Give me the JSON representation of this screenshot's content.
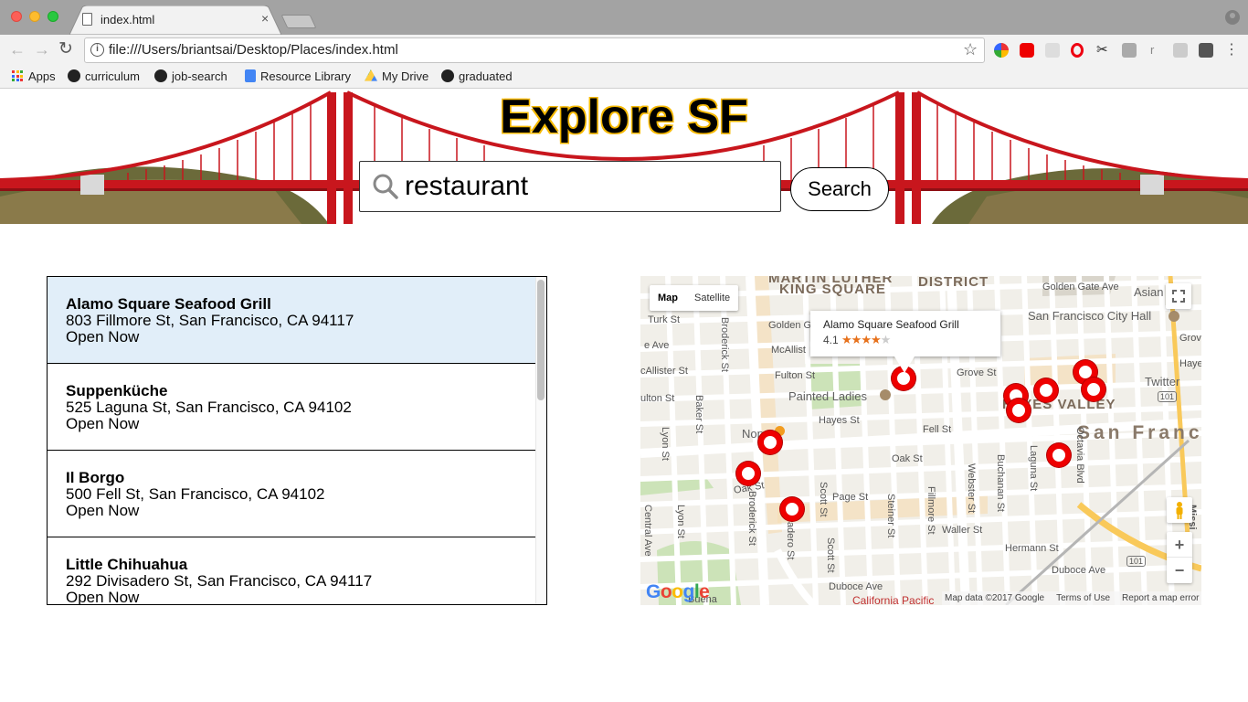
{
  "browser": {
    "tab_title": "index.html",
    "tab_close": "×",
    "url": "file:///Users/briantsai/Desktop/Places/index.html",
    "bookmarks": [
      {
        "label": "Apps",
        "icon": "apps-grid-icon"
      },
      {
        "label": "curriculum",
        "icon": "github-icon"
      },
      {
        "label": "job-search",
        "icon": "github-icon"
      },
      {
        "label": "Resource Library",
        "icon": "google-docs-icon"
      },
      {
        "label": "My Drive",
        "icon": "google-drive-icon"
      },
      {
        "label": "graduated",
        "icon": "github-icon"
      }
    ]
  },
  "header": {
    "title": "Explore SF",
    "search_value": "restaurant",
    "search_button": "Search"
  },
  "results": [
    {
      "name": "Alamo Square Seafood Grill",
      "address": "803 Fillmore St, San Francisco, CA 94117",
      "status": "Open Now",
      "selected": true
    },
    {
      "name": "Suppenküche",
      "address": "525 Laguna St, San Francisco, CA 94102",
      "status": "Open Now",
      "selected": false
    },
    {
      "name": "Il Borgo",
      "address": "500 Fell St, San Francisco, CA 94102",
      "status": "Open Now",
      "selected": false
    },
    {
      "name": "Little Chihuahua",
      "address": "292 Divisadero St, San Francisco, CA 94117",
      "status": "Open Now",
      "selected": false
    }
  ],
  "map": {
    "type_buttons": [
      "Map",
      "Satellite"
    ],
    "selected_type": "Map",
    "infowindow": {
      "name": "Alamo Square Seafood Grill",
      "rating": "4.1"
    },
    "zoom_in": "+",
    "zoom_out": "−",
    "footer": [
      "Map data ©2017 Google",
      "Terms of Use",
      "Report a map error"
    ],
    "logo": "Google",
    "labels": {
      "martin_luther": "MARTIN LUTHER",
      "king_square": "KING SQUARE",
      "district": "DISTRICT",
      "hayes_valley": "HAYES VALLEY",
      "san_franc": "San Franc",
      "painted_ladies": "Painted Ladies",
      "city_hall": "San Francisco City Hall",
      "asian_art": "Asian Ar",
      "nopa": "Nop",
      "twitter": "Twitter",
      "golden_gate_ave": "Golden Gate Ave",
      "golden_g": "Golden G",
      "turk_st": "Turk St",
      "grove_st": "Grove St",
      "grove_s": "Grove S",
      "hayes_st": "Hayes St",
      "hayes": "Hayes",
      "fell_st": "Fell St",
      "oak_st": "Oak St",
      "oak_st_2": "Oak St",
      "page_st": "Page St",
      "waller_st": "Waller St",
      "hermann_st": "Hermann St",
      "duboce_ave": "Duboce Ave",
      "duboce_ave_2": "Duboce Ave",
      "mcallister": "McAllist",
      "mcallister_st": "cAllister St",
      "fulton_st": "Fulton St",
      "ulton_st": "ulton St",
      "e_ave": "e Ave",
      "broderick": "Broderick St",
      "broderick_2": "Broderick St",
      "baker_st": "Baker St",
      "lyon_st": "Lyon St",
      "lyon_st_2": "Lyon St",
      "central_ave": "Central Ave",
      "divisadero": "Divisadero St",
      "scott_st": "Scott St",
      "scott_st_2": "Scott St",
      "steiner_st": "Steiner St",
      "fillmore_st": "Fillmore St",
      "webster_st": "Webster St",
      "buchanan_st": "Buchanan St",
      "laguna_st": "Laguna St",
      "octavia_blvd": "Octavia Blvd",
      "california_pacific": "California Pacific",
      "mission": "Missi",
      "buena": "Buena",
      "route_101": "101",
      "route_101_2": "101"
    }
  },
  "colors": {
    "selected_row": "#e1eef9",
    "marker_red": "#e00000",
    "title_outline": "#f5b800",
    "bridge_red": "#c8161d"
  }
}
